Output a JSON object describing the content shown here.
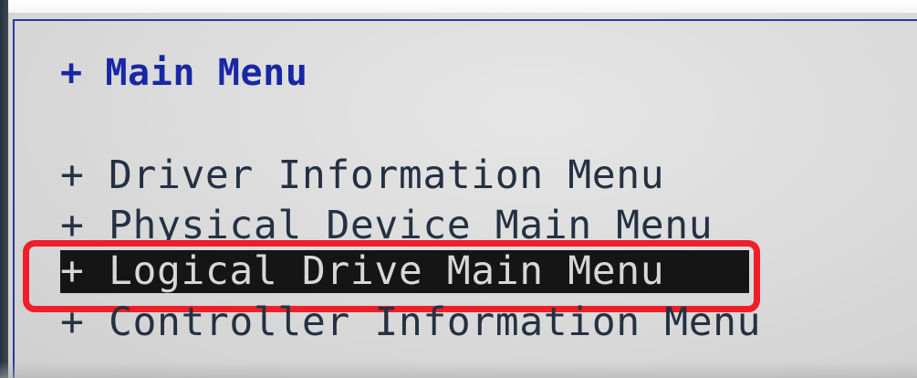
{
  "menu": {
    "title": "+ Main Menu",
    "items": [
      {
        "label": "+ Driver Information Menu"
      },
      {
        "label": "+ Physical Device Main Menu"
      },
      {
        "label": "+ Logical Drive Main Menu"
      },
      {
        "label": "+ Controller Information Menu"
      }
    ]
  },
  "colors": {
    "background": "#dcdcdc",
    "title": "#1827a4",
    "text": "#253142",
    "selection_background": "#151515",
    "selection_text": "#d7d7d7",
    "highlight_outline": "#ef1f2a",
    "frame_border": "#273a9b"
  }
}
